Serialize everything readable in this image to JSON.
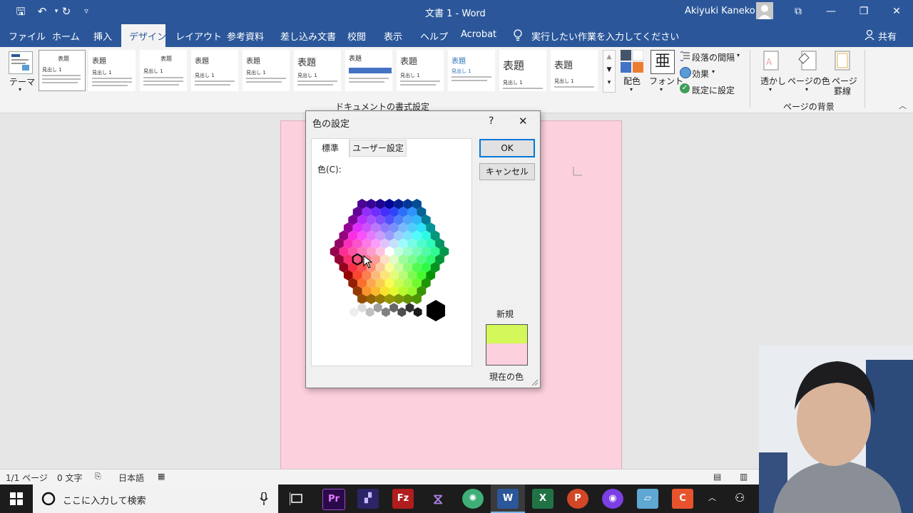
{
  "window": {
    "doc_title": "文書 1 - Word",
    "user_name": "Akiyuki Kaneko",
    "controls": {
      "restore_ribbon": "⧉",
      "minimize": "—",
      "maximize": "❐",
      "close": "✕"
    }
  },
  "quick_access": {
    "save": "🖫",
    "undo": "↶",
    "redo": "↻",
    "customize": "▿"
  },
  "menu": {
    "tabs": [
      "ファイル",
      "ホーム",
      "挿入",
      "デザイン",
      "レイアウト",
      "参考資料",
      "差し込み文書",
      "校閲",
      "表示",
      "ヘルプ",
      "Acrobat"
    ],
    "active_tab": "デザイン",
    "tell_me": "実行したい作業を入力してください",
    "share": "共有"
  },
  "ribbon": {
    "theme_label": "テーマ",
    "styles": [
      {
        "title": "表題",
        "sub": "見出し 1"
      },
      {
        "title": "表題",
        "sub": "見出し 1"
      },
      {
        "title": "表題",
        "sub": "見出し 1"
      },
      {
        "title": "表題",
        "sub": "見出し 1"
      },
      {
        "title": "表題",
        "sub": "見出し 1"
      },
      {
        "title": "表題",
        "sub": "見出し 1"
      },
      {
        "title": "表題",
        "sub": "見出し 1"
      },
      {
        "title": "表題",
        "sub": "見出し 1"
      },
      {
        "title": "表題",
        "sub": "見出し 1"
      },
      {
        "title": "表題",
        "sub": "見出し 1"
      },
      {
        "title": "表題",
        "sub": "見出し 1"
      }
    ],
    "colors_label": "配色",
    "fonts_label": "フォント",
    "paragraph_spacing": "段落の間隔",
    "effects": "効果",
    "set_default": "既定に設定",
    "doc_format_group": "ドキュメントの書式設定",
    "watermark": "透かし",
    "page_color": "ページの色",
    "page_borders_1": "ページ",
    "page_borders_2": "罫線",
    "page_bg_group": "ページの背景"
  },
  "dialog": {
    "title": "色の設定",
    "help": "?",
    "close": "✕",
    "tab_standard": "標準",
    "tab_custom": "ユーザー設定",
    "colors_label": "色(C):",
    "ok": "OK",
    "cancel": "キャンセル",
    "new_label": "新規",
    "current_label": "現在の色",
    "new_color": "#d4f75a",
    "current_color": "#fdd0dd"
  },
  "statusbar": {
    "page": "1/1 ページ",
    "words": "0 文字",
    "language": "日本語"
  },
  "taskbar": {
    "search_placeholder": "ここに入力して検索"
  },
  "colors": {
    "accent": "#2b579a",
    "page": "#fdd0dd"
  }
}
